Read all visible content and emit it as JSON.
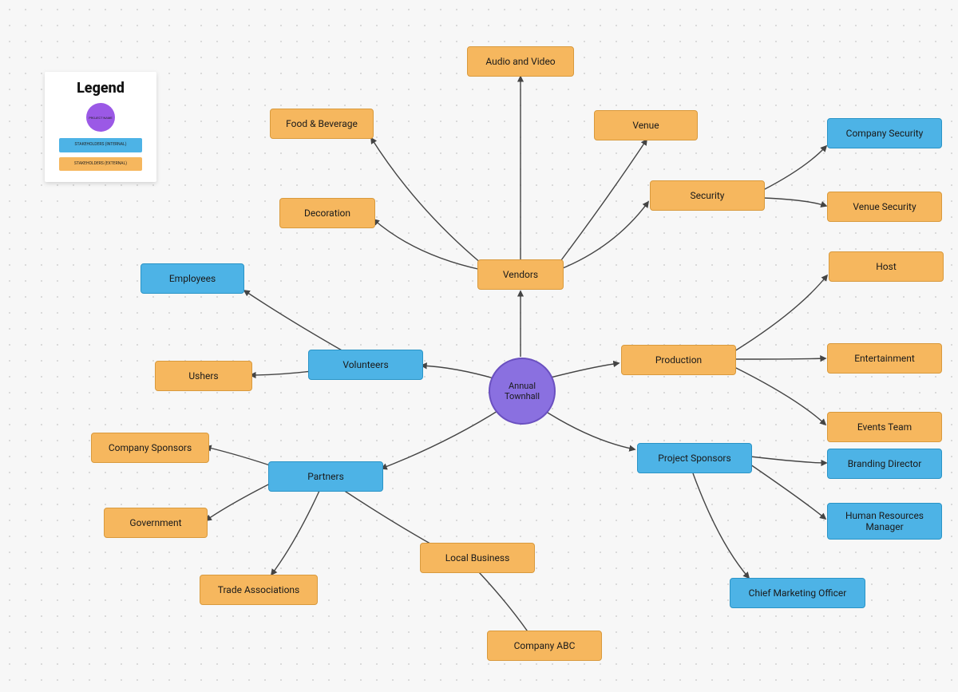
{
  "legend": {
    "title": "Legend",
    "center_label": "PROJECT NAME",
    "internal_label": "STAKEHOLDERS (INTERNAL)",
    "external_label": "STAKEHOLDERS (EXTERNAL)"
  },
  "center": {
    "label": "Annual Townhall"
  },
  "nodes": {
    "vendors": "Vendors",
    "audio_video": "Audio and Video",
    "food_beverage": "Food & Beverage",
    "venue": "Venue",
    "decoration": "Decoration",
    "security": "Security",
    "company_security": "Company Security",
    "venue_security": "Venue Security",
    "production": "Production",
    "host": "Host",
    "entertainment": "Entertainment",
    "events_team": "Events Team",
    "project_sponsors": "Project Sponsors",
    "branding_director": "Branding Director",
    "hr_manager": "Human Resources Manager",
    "cmo": "Chief Marketing Officer",
    "volunteers": "Volunteers",
    "employees": "Employees",
    "ushers": "Ushers",
    "partners": "Partners",
    "company_sponsors": "Company Sponsors",
    "government": "Government",
    "trade_associations": "Trade Associations",
    "local_business": "Local Business",
    "company_abc": "Company ABC"
  }
}
